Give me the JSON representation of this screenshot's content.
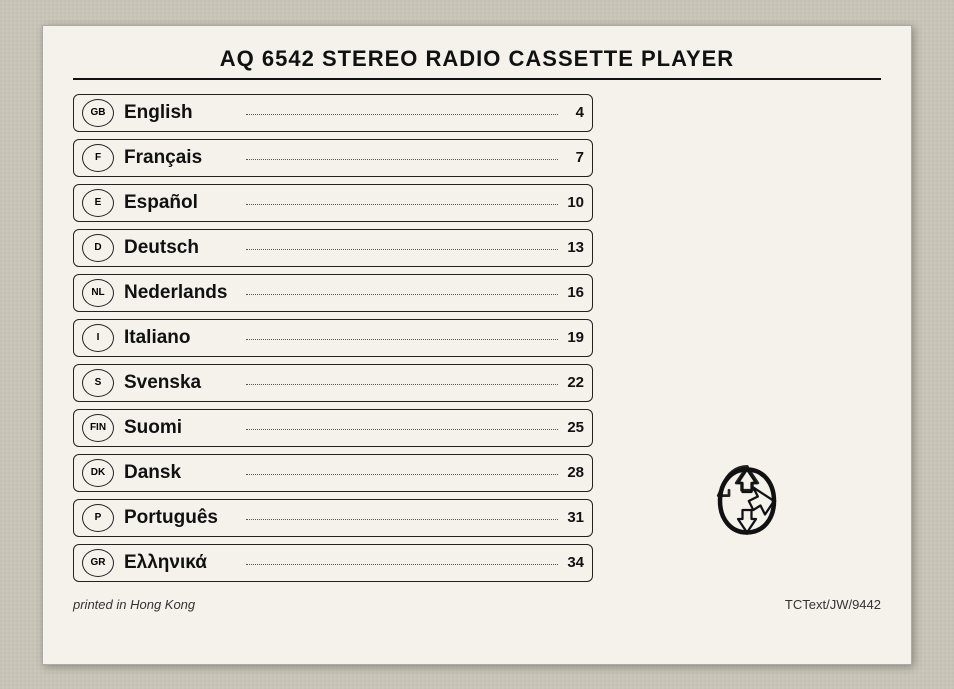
{
  "page": {
    "title": "AQ 6542 STEREO RADIO CASSETTE PLAYER"
  },
  "languages": [
    {
      "code": "GB",
      "name": "English",
      "page": "4"
    },
    {
      "code": "F",
      "name": "Français",
      "page": "7"
    },
    {
      "code": "E",
      "name": "Español",
      "page": "10"
    },
    {
      "code": "D",
      "name": "Deutsch",
      "page": "13"
    },
    {
      "code": "NL",
      "name": "Nederlands",
      "page": "16"
    },
    {
      "code": "I",
      "name": "Italiano",
      "page": "19"
    },
    {
      "code": "S",
      "name": "Svenska",
      "page": "22"
    },
    {
      "code": "FIN",
      "name": "Suomi",
      "page": "25"
    },
    {
      "code": "DK",
      "name": "Dansk",
      "page": "28"
    },
    {
      "code": "P",
      "name": "Português",
      "page": "31"
    },
    {
      "code": "GR",
      "name": "Ελληνικά",
      "page": "34"
    }
  ],
  "footer": {
    "printed": "printed in Hong Kong",
    "code": "TCText/JW/9442"
  }
}
